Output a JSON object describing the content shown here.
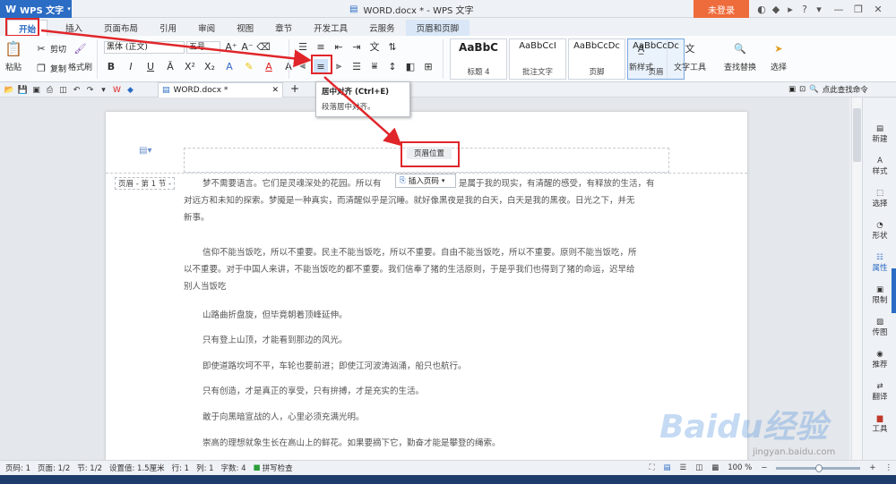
{
  "app": {
    "name": "WPS 文字",
    "window_title": "WORD.docx * - WPS 文字",
    "login": "未登录"
  },
  "tabs": [
    "开始",
    "插入",
    "页面布局",
    "引用",
    "审阅",
    "视图",
    "章节",
    "开发工具",
    "云服务",
    "页眉和页脚"
  ],
  "ribbon": {
    "paste": "粘贴",
    "cut": "剪切",
    "copy": "复制",
    "format_painter": "格式刷",
    "font_name": "黑体 (正文)",
    "font_size": "五号",
    "styles": [
      {
        "preview": "AaBbC",
        "label": "标题 4"
      },
      {
        "preview": "AaBbCcI",
        "label": "批注文字"
      },
      {
        "preview": "AaBbCcDc",
        "label": "页脚"
      },
      {
        "preview": "AaBbCcDc",
        "label": "页眉"
      }
    ],
    "new_style": "新样式",
    "text_tools": "文字工具",
    "find_replace": "查找替换",
    "select": "选择"
  },
  "doc_tab": "WORD.docx *",
  "quick_search": "点此查找命令",
  "tooltip": {
    "title": "居中对齐 (Ctrl+E)",
    "desc": "段落居中对齐。"
  },
  "header": {
    "position_label": "页眉位置",
    "section_label": "页眉 - 第 1 节 -",
    "insert_page_num": "插入页码"
  },
  "paragraphs": [
    "梦不需要语言。它们是灵魂深处的花园。所以有",
    "是属于我的现实，有清醒的感受，有释放的生活，有",
    "对远方和未知的探索。梦魇是一种真实，而清醒似乎是沉睡。就好像黑夜是我的白天，白天是我的黑夜。日光之下，并无",
    "新事。",
    "信仰不能当饭吃，所以不重要。民主不能当饭吃，所以不重要。自由不能当饭吃，所以不重要。原则不能当饭吃，所",
    "以不重要。对于中国人来讲，不能当饭吃的都不重要。我们信奉了猪的生活原则，于是乎我们也得到了猪的命运，迟早给",
    "别人当饭吃",
    "山路曲折盘旋，但毕竟朝着顶峰延伸。",
    "只有登上山顶，才能看到那边的风光。",
    "即使道路坎坷不平，车轮也要前进；即使江河波涛汹涌，船只也航行。",
    "只有创造，才是真正的享受，只有拚搏，才是充实的生活。",
    "敢于向黑暗宣战的人，心里必须充满光明。",
    "崇高的理想就象生长在高山上的鲜花。如果要摘下它，勤奋才能是攀登的绳索。"
  ],
  "right_panel": [
    "新建",
    "样式",
    "选择",
    "形状",
    "属性",
    "限制",
    "传图",
    "推荐",
    "翻译",
    "工具"
  ],
  "status": {
    "page": "页码: 1",
    "pages": "页面: 1/2",
    "section": "节: 1/2",
    "setting": "设置值: 1.5厘米",
    "row": "行: 1",
    "col": "列: 1",
    "words": "字数: 4",
    "spell": "拼写检查",
    "zoom": "100 %"
  },
  "watermark": {
    "main": "Baidu经验",
    "sub": "jingyan.baidu.com"
  },
  "colors": {
    "accent": "#2b6cc4",
    "highlight": "#e0262a",
    "login": "#ee6b3b"
  }
}
